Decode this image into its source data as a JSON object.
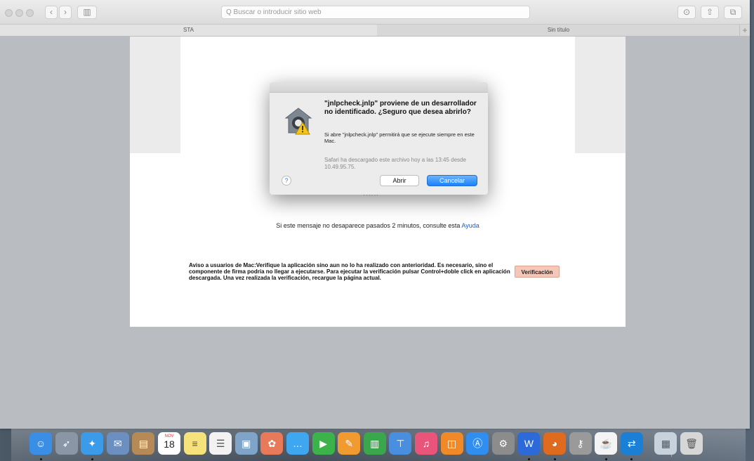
{
  "browser": {
    "address_placeholder": "Q Buscar o introducir sitio web",
    "tabs": [
      {
        "label": "STA"
      },
      {
        "label": "Sin título"
      }
    ],
    "new_tab": "+"
  },
  "page": {
    "spinner": "´/ııı\\\\`",
    "message": "Si este mensaje no desaparece pasados 2 minutos, consulte esta",
    "help_link": "Ayuda",
    "notice": "Aviso a usuarios de Mac:Verifique la aplicación sino aun no lo ha realizado con anterioridad. Es necesario, sino el componente de firma podría no llegar a ejecutarse. Para ejecutar la verificación pulsar Control+doble click en aplicación descargada. Una vez realizada la verificación, recargue la página actual.",
    "verify_button": "Verificación"
  },
  "dialog": {
    "title": "\"jnlpcheck.jnlp\" proviene de un desarrollador no identificado. ¿Seguro que desea abrirlo?",
    "body": "Si abre \"jnlpcheck.jnlp\" permitirá que se ejecute siempre en este Mac.",
    "info": "Safari ha descargado este archivo hoy a las 13:45 desde 10.49.95.75.",
    "help": "?",
    "open_button": "Abrir",
    "cancel_button": "Cancelar"
  },
  "dock": {
    "calendar_month": "NOV",
    "calendar_day": "18",
    "apps": [
      {
        "icon": "finder-icon",
        "color": "#3a8ee6",
        "glyph": "☺",
        "running": true
      },
      {
        "icon": "launchpad-icon",
        "color": "#8a96a6",
        "glyph": "➶",
        "running": false
      },
      {
        "icon": "safari-icon",
        "color": "#3c9be8",
        "glyph": "✦",
        "running": true
      },
      {
        "icon": "mail-icon",
        "color": "#6b8fc0",
        "glyph": "✉",
        "running": false
      },
      {
        "icon": "contacts-icon",
        "color": "#b58a56",
        "glyph": "▤",
        "running": false
      },
      {
        "icon": "calendar-icon",
        "color": "#ffffff",
        "glyph": "",
        "running": false
      },
      {
        "icon": "notes-icon",
        "color": "#f5e27a",
        "glyph": "≡",
        "running": false
      },
      {
        "icon": "reminders-icon",
        "color": "#f2f2f2",
        "glyph": "☰",
        "running": false
      },
      {
        "icon": "preview-icon",
        "color": "#7fa4c8",
        "glyph": "▣",
        "running": false
      },
      {
        "icon": "photos-icon",
        "color": "#e87a5a",
        "glyph": "✿",
        "running": false
      },
      {
        "icon": "messages-icon",
        "color": "#3fa7f0",
        "glyph": "…",
        "running": false
      },
      {
        "icon": "facetime-icon",
        "color": "#3cb34a",
        "glyph": "▶",
        "running": false
      },
      {
        "icon": "pages-icon",
        "color": "#f09a30",
        "glyph": "✎",
        "running": false
      },
      {
        "icon": "numbers-icon",
        "color": "#3aa74c",
        "glyph": "▥",
        "running": false
      },
      {
        "icon": "keynote-icon",
        "color": "#4a8ee0",
        "glyph": "⊤",
        "running": false
      },
      {
        "icon": "itunes-icon",
        "color": "#e8547a",
        "glyph": "♫",
        "running": false
      },
      {
        "icon": "ibooks-icon",
        "color": "#f08a28",
        "glyph": "◫",
        "running": false
      },
      {
        "icon": "app-store-icon",
        "color": "#2f8ef0",
        "glyph": "Ⓐ",
        "running": false
      },
      {
        "icon": "system-preferences-icon",
        "color": "#8c8c8c",
        "glyph": "⚙",
        "running": false
      },
      {
        "icon": "word-icon",
        "color": "#2b6ad8",
        "glyph": "W",
        "running": true
      },
      {
        "icon": "firefox-icon",
        "color": "#e06a1e",
        "glyph": "◕",
        "running": true
      },
      {
        "icon": "keychain-icon",
        "color": "#9a9a9a",
        "glyph": "⚷",
        "running": false
      },
      {
        "icon": "java-icon",
        "color": "#f4f4f4",
        "glyph": "☕",
        "running": true
      },
      {
        "icon": "teamviewer-icon",
        "color": "#1b7fd6",
        "glyph": "⇄",
        "running": true
      },
      {
        "icon": "downloads-stack-icon",
        "color": "#c8d2dc",
        "glyph": "▦",
        "running": false
      },
      {
        "icon": "trash-icon",
        "color": "#d6d6d6",
        "glyph": "🗑",
        "running": false
      }
    ]
  },
  "colors": {
    "accent": "#1a82fb",
    "verify_button_bg": "#f6c7b8",
    "page_bg": "#ffffff",
    "window_bg": "#b9bdc1"
  }
}
